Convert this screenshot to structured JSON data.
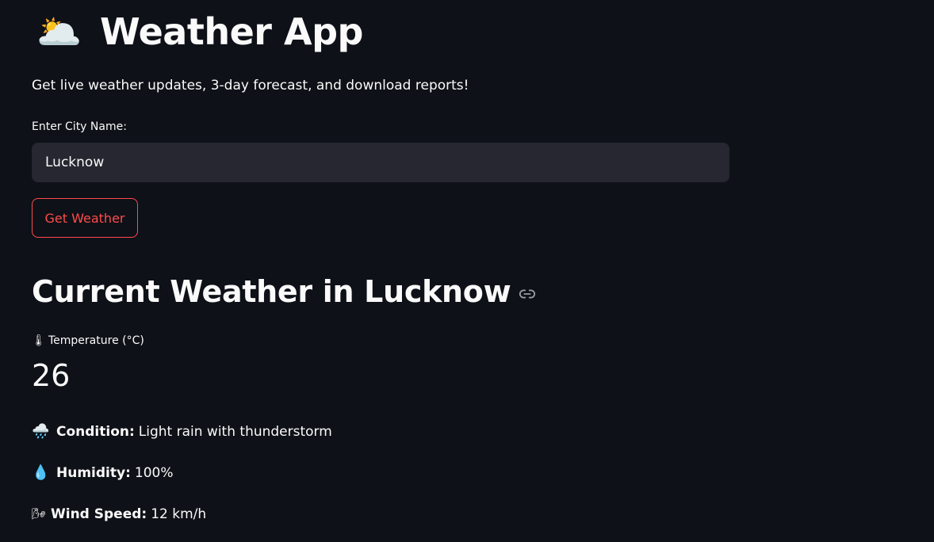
{
  "header": {
    "title_icon": "sun-behind-cloud-icon",
    "title_emoji": "🌥️",
    "title": "Weather App",
    "subtitle": "Get live weather updates, 3-day forecast, and download reports!"
  },
  "form": {
    "city_label": "Enter City Name:",
    "city_value": "Lucknow",
    "button_label": "Get Weather",
    "button_color": "#ff4b4b"
  },
  "current": {
    "heading": "Current Weather in Lucknow",
    "link_icon": "link-icon",
    "temperature_icon": "thermometer-icon",
    "temperature_emoji": "🌡",
    "temperature_label": "Temperature (°C)",
    "temperature_value": "26",
    "condition_icon": "cloud-rain-icon",
    "condition_emoji": "🌧️",
    "condition_label": "Condition:",
    "condition_value": "Light rain with thunderstorm",
    "humidity_icon": "droplet-icon",
    "humidity_emoji": "💧",
    "humidity_label": "Humidity:",
    "humidity_value": "100%",
    "wind_icon": "wind-icon",
    "wind_emoji": "🌬",
    "wind_label": "Wind Speed:",
    "wind_value": "12 km/h"
  },
  "colors": {
    "background": "#0e1117",
    "input_bg": "#262730",
    "accent": "#ff4b4b",
    "text": "#fafafa"
  }
}
